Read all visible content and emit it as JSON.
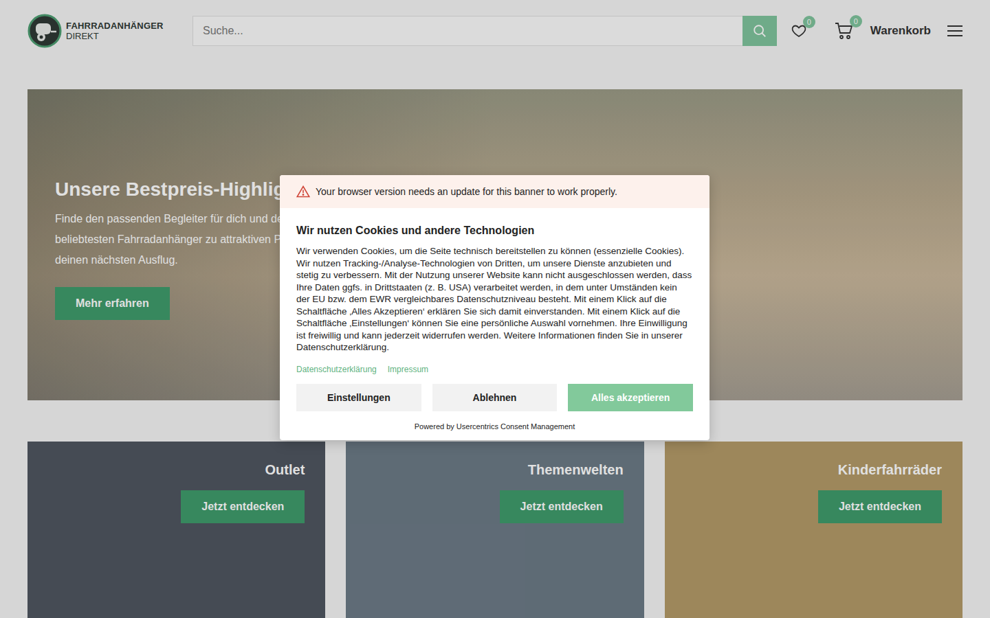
{
  "header": {
    "logo": {
      "line1": "FAHRRADANHÄNGER",
      "line2": "DIREKT"
    },
    "search": {
      "placeholder": "Suche..."
    },
    "wishlist": {
      "count": "0"
    },
    "cart": {
      "count": "0",
      "label": "Warenkorb"
    }
  },
  "hero": {
    "title": "Unsere Bestpreis-Highlig",
    "lines": [
      "Finde den passenden Begleiter für dich und de",
      "beliebtesten Fahrradanhänger zu attraktiven Pr",
      "deinen nächsten Ausflug."
    ],
    "button": "Mehr erfahren"
  },
  "categories": [
    {
      "title": "Outlet",
      "button": "Jetzt entdecken",
      "color": "#4f5660"
    },
    {
      "title": "Themenwelten",
      "button": "Jetzt entdecken",
      "color": "#6c7a86"
    },
    {
      "title": "Kinderfahrräder",
      "button": "Jetzt entdecken",
      "color": "#b39a68"
    }
  ],
  "cookie_banner": {
    "warning": "Your browser version needs an update for this banner to work properly.",
    "title": "Wir nutzen Cookies und andere Technologien",
    "text": "Wir verwenden Cookies, um die Seite technisch bereitstellen zu können (essenzielle Cookies). Wir nutzen Tracking-/Analyse-Technologien von Dritten, um unsere Dienste anzubieten und stetig zu verbessern. Mit der Nutzung unserer Website kann nicht ausgeschlossen werden, dass Ihre Daten ggfs. in Drittstaaten (z. B. USA) verarbeitet werden, in dem unter Umständen kein der EU bzw. dem EWR vergleichbares Datenschutzniveau besteht. Mit einem Klick auf die Schaltfläche ‚Alles Akzeptieren‘ erklären Sie sich damit einverstanden. Mit einem Klick auf die Schaltfläche ‚Einstellungen‘ können Sie eine persönliche Auswahl vornehmen. Ihre Einwilligung ist freiwillig und kann jederzeit widerrufen werden. Weitere Informationen finden Sie in unserer Datenschutzerklärung.",
    "links": [
      "Datenschutzerklärung",
      "Impressum"
    ],
    "buttons": [
      {
        "label": "Einstellungen",
        "primary": false
      },
      {
        "label": "Ablehnen",
        "primary": false
      },
      {
        "label": "Alles akzeptieren",
        "primary": true
      }
    ],
    "footer": "Powered by Usercentrics Consent Management"
  }
}
